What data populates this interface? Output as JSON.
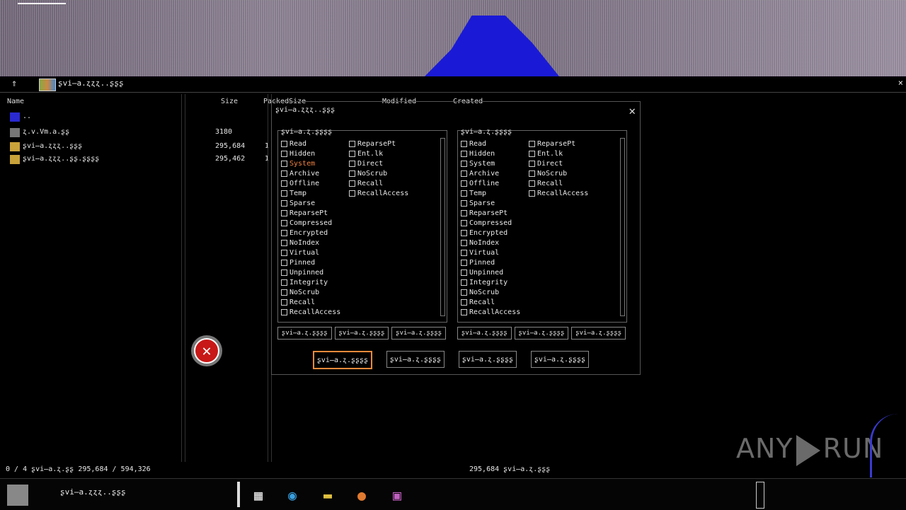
{
  "window": {
    "title": "ʂvi̶a.ʐʐʐ..ʂʂʂ",
    "columns": {
      "name": "Name",
      "size": "Size",
      "packed": "PackedSize",
      "modified": "Modified",
      "created": "Created"
    }
  },
  "files": [
    {
      "name": "..",
      "size": "",
      "extra": ""
    },
    {
      "name": "ʐ.v.Vm.a.ʂʂ",
      "size": "3180",
      "extra": ""
    },
    {
      "name": "ʂvi̶a.ʐʐʐ..ʂʂʂ",
      "size": "295,684",
      "extra": "1"
    },
    {
      "name": "ʂvi̶a.ʐʐʐ..ʂʂ.ʂʂʂʂ",
      "size": "295,462",
      "extra": "1"
    }
  ],
  "dialog": {
    "title": "ʂvi̶a.ʐʐʐ..ʂʂʂ",
    "close_label": "✕",
    "left_pane": {
      "header": "ʂvi̶a.ʐ.ʂʂʂʂ",
      "col1": [
        "Read",
        "Hidden",
        "System",
        "Archive",
        "Offline",
        "Temp",
        "Sparse",
        "ReparsePt",
        "Compressed",
        "Encrypted",
        "NoIndex",
        "Virtual",
        "Pinned",
        "Unpinned",
        "Integrity",
        "NoScrub",
        "Recall",
        "RecallAccess"
      ],
      "col2": [
        "ReparsePt",
        "Ent.lk",
        "Direct",
        "NoScrub",
        "Recall",
        "RecallAccess"
      ],
      "buttons": [
        "ʂvi̶a.ʐ.ʂʂʂʂ",
        "ʂvi̶a.ʐ.ʂʂʂʂ",
        "ʂvi̶a.ʐ.ʂʂʂʂ"
      ]
    },
    "right_pane": {
      "header": "ʂvi̶a.ʐ.ʂʂʂʂ",
      "col1": [
        "Read",
        "Hidden",
        "System",
        "Archive",
        "Offline",
        "Temp",
        "Sparse",
        "ReparsePt",
        "Compressed",
        "Encrypted",
        "NoIndex",
        "Virtual",
        "Pinned",
        "Unpinned",
        "Integrity",
        "NoScrub",
        "Recall",
        "RecallAccess"
      ],
      "col2": [
        "ReparsePt",
        "Ent.lk",
        "Direct",
        "NoScrub",
        "Recall",
        "RecallAccess"
      ],
      "buttons": [
        "ʂvi̶a.ʐ.ʂʂʂʂ",
        "ʂvi̶a.ʐ.ʂʂʂʂ",
        "ʂvi̶a.ʐ.ʂʂʂʂ"
      ]
    },
    "bottom_buttons": [
      "ʂvi̶a.ʐ.ʂʂʂʂ",
      "ʂvi̶a.ʐ.ʂʂʂʂ",
      "ʂvi̶a.ʐ.ʂʂʂʂ",
      "ʂvi̶a.ʐ.ʂʂʂʂ"
    ]
  },
  "error_icon": {
    "glyph": "✕"
  },
  "statusbar": {
    "left": "0 / 4 ʂvi̶a.ʐ.ʂʂ 295,684 / 594,326",
    "mid": "295,684  ʂvi̶a.ʐ.ʂʂʂ"
  },
  "watermark": {
    "left": "ANY",
    "right": "RUN"
  },
  "taskbar": {
    "search": "ʂvi̶a.ʐʐʐ..ʂʂʂ",
    "icons": [
      "task-view-icon",
      "edge-icon",
      "explorer-icon",
      "firefox-icon",
      "archiver-icon"
    ]
  },
  "colors": {
    "accent": "#f08a3c",
    "error": "#c81818",
    "noise_blue": "#1a1ad6"
  }
}
